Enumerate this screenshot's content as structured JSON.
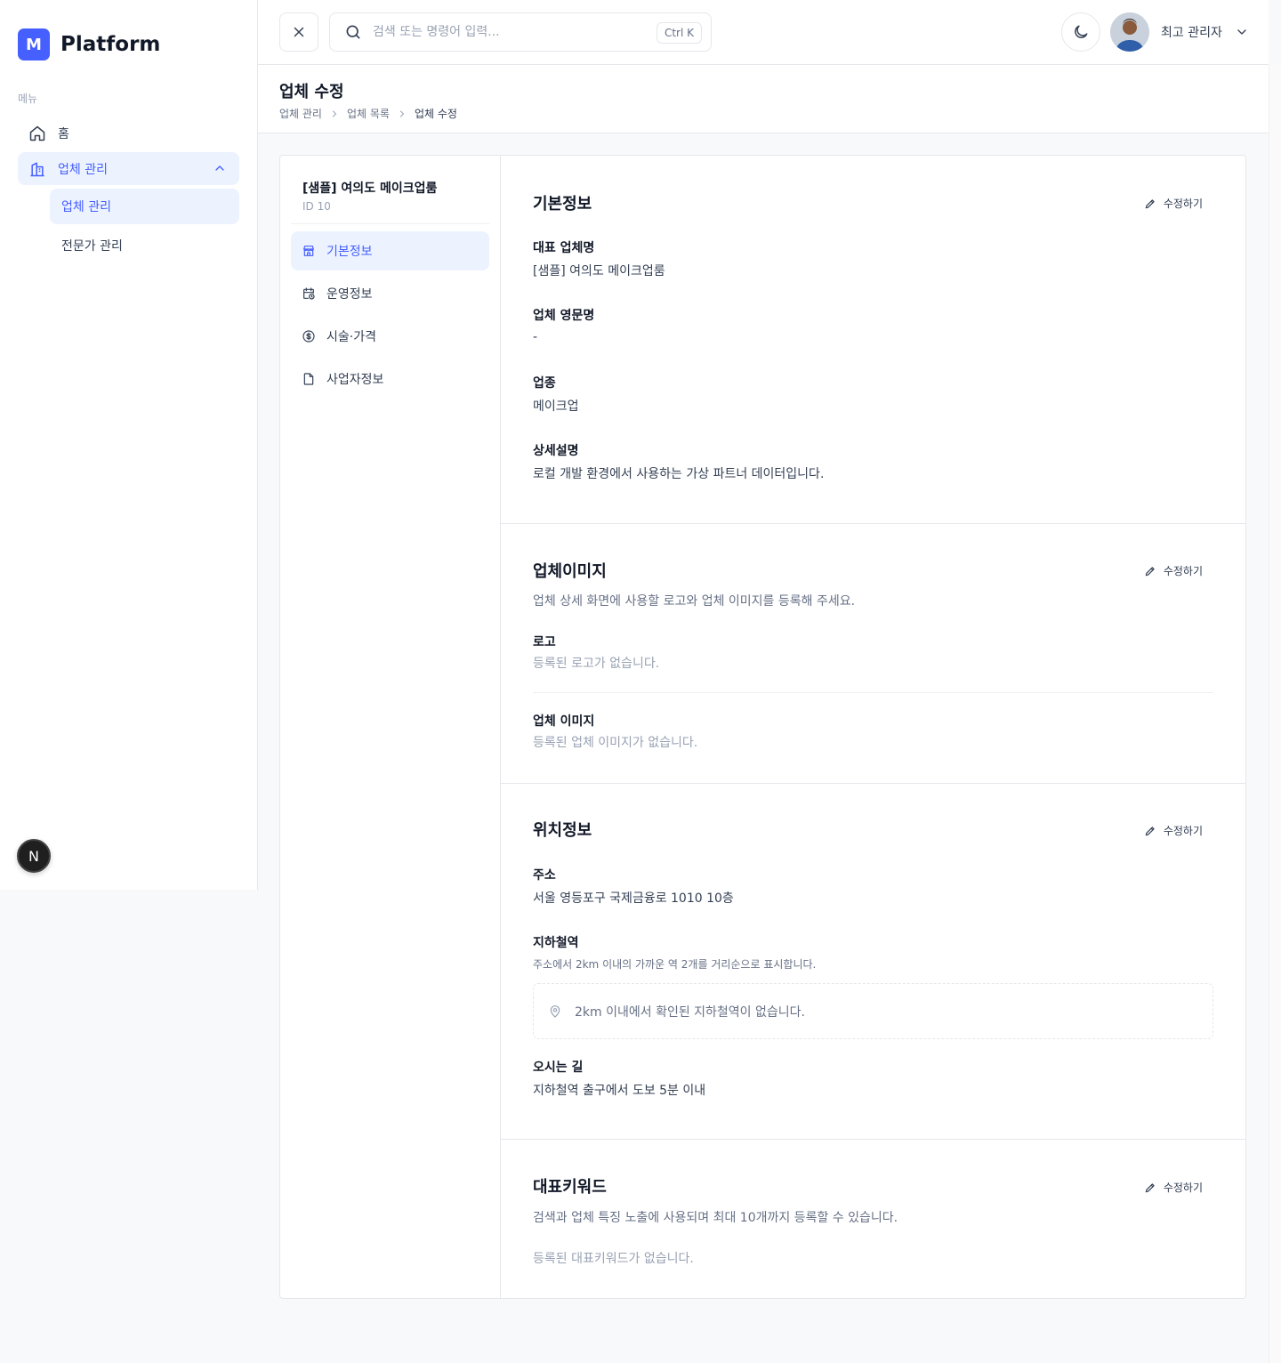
{
  "sidebar": {
    "brand_letter": "M",
    "brand_name": "Platform",
    "menu_label": "메뉴",
    "items": [
      {
        "label": "홈",
        "icon": "home-icon"
      },
      {
        "label": "업체 관리",
        "icon": "building-icon",
        "expanded": true
      }
    ],
    "sub_items": [
      {
        "label": "업체 관리",
        "active": true
      },
      {
        "label": "전문가 관리",
        "active": false
      }
    ],
    "dev_badge": "N"
  },
  "header": {
    "search_placeholder": "검색 또는 명령어 입력...",
    "shortcut": "Ctrl K",
    "user_name": "최고 관리자"
  },
  "page": {
    "title": "업체 수정",
    "breadcrumb": [
      "업체 관리",
      "업체 목록",
      "업체 수정"
    ]
  },
  "left_nav": {
    "company_name": "[샘플] 여의도 메이크업룸",
    "company_id": "ID 10",
    "items": [
      {
        "label": "기본정보",
        "icon": "store-icon",
        "active": true
      },
      {
        "label": "운영정보",
        "icon": "calendar-clock-icon",
        "active": false
      },
      {
        "label": "시술·가격",
        "icon": "dollar-circle-icon",
        "active": false
      },
      {
        "label": "사업자정보",
        "icon": "file-icon",
        "active": false
      }
    ]
  },
  "edit_label": "수정하기",
  "basic": {
    "title": "기본정보",
    "fields": [
      {
        "label": "대표 업체명",
        "value": "[샘플] 여의도 메이크업룸"
      },
      {
        "label": "업체 영문명",
        "value": "-"
      },
      {
        "label": "업종",
        "value": "메이크업"
      },
      {
        "label": "상세설명",
        "value": "로컬 개발 환경에서 사용하는 가상 파트너 데이터입니다."
      }
    ]
  },
  "images": {
    "title": "업체이미지",
    "description": "업체 상세 화면에 사용할 로고와 업체 이미지를 등록해 주세요.",
    "logo_label": "로고",
    "logo_empty": "등록된 로고가 없습니다.",
    "image_label": "업체 이미지",
    "image_empty": "등록된 업체 이미지가 없습니다."
  },
  "location": {
    "title": "위치정보",
    "address_label": "주소",
    "address_value": "서울 영등포구 국제금융로 1010 10층",
    "subway_label": "지하철역",
    "subway_hint": "주소에서 2km 이내의 가까운 역 2개를 거리순으로 표시합니다.",
    "subway_empty": "2km 이내에서 확인된 지하철역이 없습니다.",
    "directions_label": "오시는 길",
    "directions_value": "지하철역 출구에서 도보 5분 이내"
  },
  "keywords": {
    "title": "대표키워드",
    "description": "검색과 업체 특징 노출에 사용되며 최대 10개까지 등록할 수 있습니다.",
    "empty": "등록된 대표키워드가 없습니다."
  }
}
